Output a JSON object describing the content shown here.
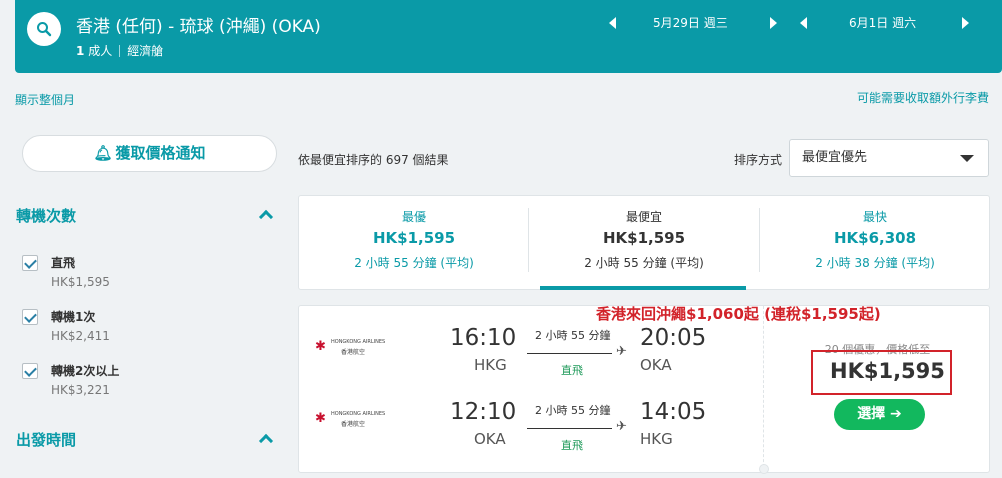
{
  "header": {
    "route": "香港 (任何) - 琉球 (沖繩) (OKA)",
    "passengers_prefix": "1",
    "passengers_suffix": "成人",
    "cabin": "經濟艙",
    "depart_date": "5月29日 週三",
    "return_date": "6月1日 週六"
  },
  "links": {
    "show_month": "顯示整個月",
    "baggage_fee": "可能需要收取額外行李費"
  },
  "sidebar": {
    "price_alert": "獲取價格通知",
    "stops_title": "轉機次數",
    "filters": [
      {
        "label": "直飛",
        "price": "HK$1,595",
        "checked": true
      },
      {
        "label": "轉機1次",
        "price": "HK$2,411",
        "checked": true
      },
      {
        "label": "轉機2次以上",
        "price": "HK$3,221",
        "checked": true
      }
    ],
    "departure_title": "出發時間"
  },
  "sort": {
    "results_text": "依最便宜排序的 697 個結果",
    "label": "排序方式",
    "value": "最便宜優先"
  },
  "tabs": [
    {
      "title": "最優",
      "price": "HK$1,595",
      "duration": "2 小時 55 分鐘 (平均)"
    },
    {
      "title": "最便宜",
      "price": "HK$1,595",
      "duration": "2 小時 55 分鐘 (平均)"
    },
    {
      "title": "最快",
      "price": "HK$6,308",
      "duration": "2 小時 38 分鐘 (平均)"
    }
  ],
  "promo": "香港來回沖繩$1,060起 (連稅$1,595起)",
  "result": {
    "airline_en": "HONGKONG AIRLINES",
    "airline_zh": "香港航空",
    "legs": [
      {
        "dep_time": "16:10",
        "dep_code": "HKG",
        "duration": "2 小時 55 分鐘",
        "stops": "直飛",
        "arr_time": "20:05",
        "arr_code": "OKA"
      },
      {
        "dep_time": "12:10",
        "dep_code": "OKA",
        "duration": "2 小時 55 分鐘",
        "stops": "直飛",
        "arr_time": "14:05",
        "arr_code": "HKG"
      }
    ],
    "deals_text": "20 個優惠，價格低至",
    "price": "HK$1,595",
    "select_label": "選擇 ➔"
  },
  "colors": {
    "brand": "#0a9aa7",
    "select": "#12b85e",
    "promo": "#d2232a"
  }
}
